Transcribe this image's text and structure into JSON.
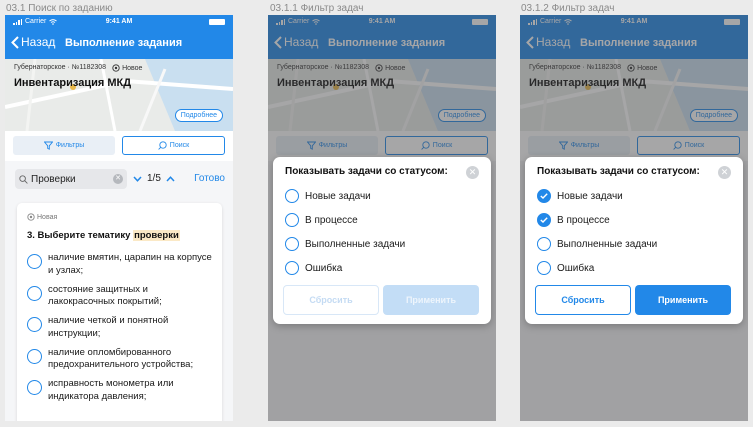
{
  "frames": [
    {
      "caption": "03.1 Поиск по заданию"
    },
    {
      "caption": "03.1.1 Фильтр задач"
    },
    {
      "caption": "03.1.2 Фильтр задач"
    }
  ],
  "status_bar": {
    "carrier": "Carrier",
    "time": "9:41 AM"
  },
  "nav": {
    "back_label": "Назад",
    "title": "Выполнение задания"
  },
  "task": {
    "address": "Губернаторское",
    "number": "№1182308",
    "status": "Новое",
    "title": "Инвентаризация МКД",
    "details_label": "Подробнее"
  },
  "toolbar": {
    "filters_label": "Фильтры",
    "search_label": "Поиск"
  },
  "search": {
    "query": "Проверки",
    "counter": "1/5",
    "done_label": "Готово"
  },
  "question_card": {
    "badge": "Новая",
    "question_prefix": "3. Выберите тематику ",
    "question_highlight": "проверки",
    "options": [
      "наличие вмятин, царапин на корпусе и узлах;",
      "состояние защитных и лакокрасочных покрытий;",
      "наличие четкой и понятной инструкции;",
      "наличие опломбированного предохранительного устройства;",
      "исправность монометра или индикатора давления;"
    ]
  },
  "filter_modal": {
    "title": "Показывать задачи со статусом:",
    "options": [
      "Новые задачи",
      "В процессе",
      "Выполненные задачи",
      "Ошибка"
    ],
    "reset_label": "Сбросить",
    "apply_label": "Применить",
    "state_empty": {
      "checked": [
        false,
        false,
        false,
        false
      ]
    },
    "state_selected": {
      "checked": [
        true,
        true,
        false,
        false
      ]
    }
  },
  "colors": {
    "accent": "#2288e8",
    "highlight": "#fbe9c6",
    "background": "#ebebeb"
  }
}
